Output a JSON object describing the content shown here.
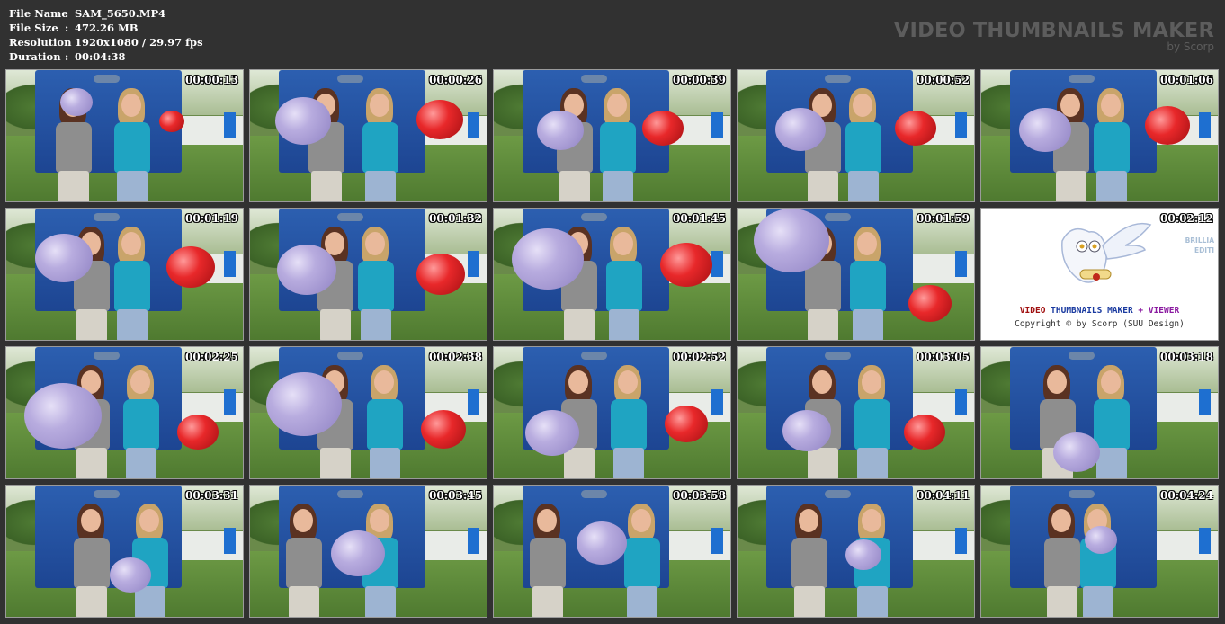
{
  "file_info": [
    {
      "label": "File Name",
      "separator": ":",
      "value": "SAM_5650.MP4"
    },
    {
      "label": "File Size",
      "separator": ":",
      "value": "472.26 MB"
    },
    {
      "label": "Resolution",
      "separator": ":",
      "value": "1920x1080 / 29.97 fps"
    },
    {
      "label": "Duration",
      "separator": ":",
      "value": "00:04:38"
    }
  ],
  "watermark": {
    "title": "VIDEO THUMBNAILS MAKER",
    "subtitle": "by Scorp"
  },
  "thumbnails": [
    {
      "time": "00:00:13",
      "kind": "frame"
    },
    {
      "time": "00:00:26",
      "kind": "frame"
    },
    {
      "time": "00:00:39",
      "kind": "frame"
    },
    {
      "time": "00:00:52",
      "kind": "frame"
    },
    {
      "time": "00:01:06",
      "kind": "frame"
    },
    {
      "time": "00:01:19",
      "kind": "frame"
    },
    {
      "time": "00:01:32",
      "kind": "frame"
    },
    {
      "time": "00:01:45",
      "kind": "frame"
    },
    {
      "time": "00:01:59",
      "kind": "frame"
    },
    {
      "time": "00:02:12",
      "kind": "logo"
    },
    {
      "time": "00:02:25",
      "kind": "frame"
    },
    {
      "time": "00:02:38",
      "kind": "frame"
    },
    {
      "time": "00:02:52",
      "kind": "frame"
    },
    {
      "time": "00:03:05",
      "kind": "frame"
    },
    {
      "time": "00:03:18",
      "kind": "frame"
    },
    {
      "time": "00:03:31",
      "kind": "frame"
    },
    {
      "time": "00:03:45",
      "kind": "frame"
    },
    {
      "time": "00:03:58",
      "kind": "frame"
    },
    {
      "time": "00:04:11",
      "kind": "frame"
    },
    {
      "time": "00:04:24",
      "kind": "frame"
    }
  ],
  "logo_tile": {
    "line1_part1": "VIDEO",
    "line1_part2": "THUMBNAILS MAKER",
    "line1_part3": "+ VIEWER",
    "line2": "Copyright © by Scorp (SUU Design)",
    "side_line1": "BRILLIA",
    "side_line2": "EDITI"
  },
  "colors": {
    "background": "#313131",
    "text": "#ffffff",
    "watermark": "#5d5d5d",
    "train_blue": "#1d4592",
    "balloon_purple": "#b8acdf",
    "balloon_red": "#e8282a"
  }
}
